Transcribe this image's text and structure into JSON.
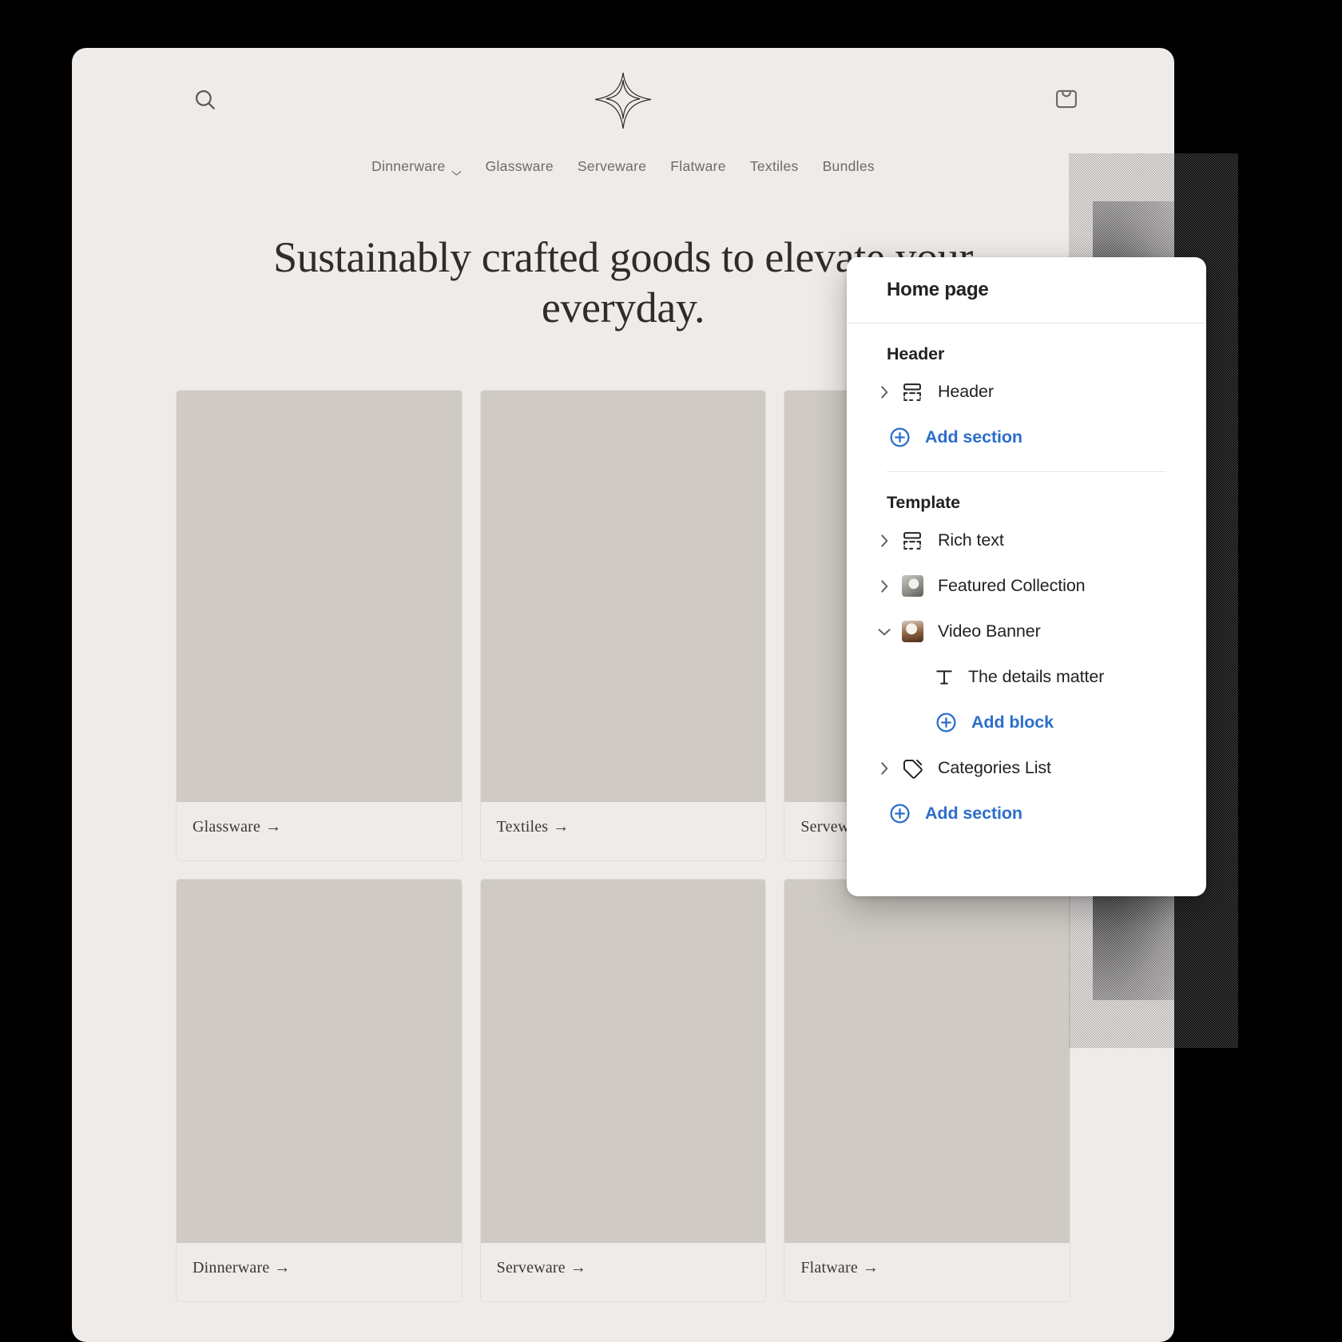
{
  "storefront": {
    "icons": {
      "search": "search-icon",
      "cart": "shopping-bag-icon",
      "logo": "four-point-star-logo"
    },
    "nav": [
      {
        "label": "Dinnerware",
        "has_caret": true
      },
      {
        "label": "Glassware",
        "has_caret": false
      },
      {
        "label": "Serveware",
        "has_caret": false
      },
      {
        "label": "Flatware",
        "has_caret": false
      },
      {
        "label": "Textiles",
        "has_caret": false
      },
      {
        "label": "Bundles",
        "has_caret": false
      }
    ],
    "hero_heading": "Sustainably crafted goods to elevate your everyday.",
    "cards": [
      {
        "label": "Glassware",
        "arrow": "→"
      },
      {
        "label": "Textiles",
        "arrow": "→"
      },
      {
        "label": "Serveware",
        "arrow": "→"
      },
      {
        "label": "Dinnerware",
        "arrow": "→"
      },
      {
        "label": "Serveware",
        "arrow": "→"
      },
      {
        "label": "Flatware",
        "arrow": "→"
      }
    ]
  },
  "panel": {
    "title": "Home page",
    "accent_color": "#2c6ecb",
    "groups": [
      {
        "title": "Header",
        "rows": [
          {
            "label": "Header",
            "icon": "section-layout-icon",
            "expander": "chevron-right-icon"
          }
        ],
        "action": {
          "label": "Add section",
          "icon": "circle-plus-icon"
        }
      },
      {
        "title": "Template",
        "rows": [
          {
            "label": "Rich text",
            "icon": "section-layout-icon",
            "expander": "chevron-right-icon"
          },
          {
            "label": "Featured Collection",
            "icon": "image-thumbnail-icon",
            "expander": "chevron-right-icon"
          },
          {
            "label": "Video Banner",
            "icon": "image-thumbnail-icon",
            "expander": "chevron-down-icon"
          },
          {
            "label": "The details matter",
            "icon": "text-block-icon",
            "expander": ""
          },
          {
            "label": "Categories List",
            "icon": "tag-icon",
            "expander": "chevron-right-icon"
          }
        ],
        "block_action": {
          "label": "Add block",
          "icon": "circle-plus-icon"
        },
        "action": {
          "label": "Add section",
          "icon": "circle-plus-icon"
        }
      }
    ]
  }
}
